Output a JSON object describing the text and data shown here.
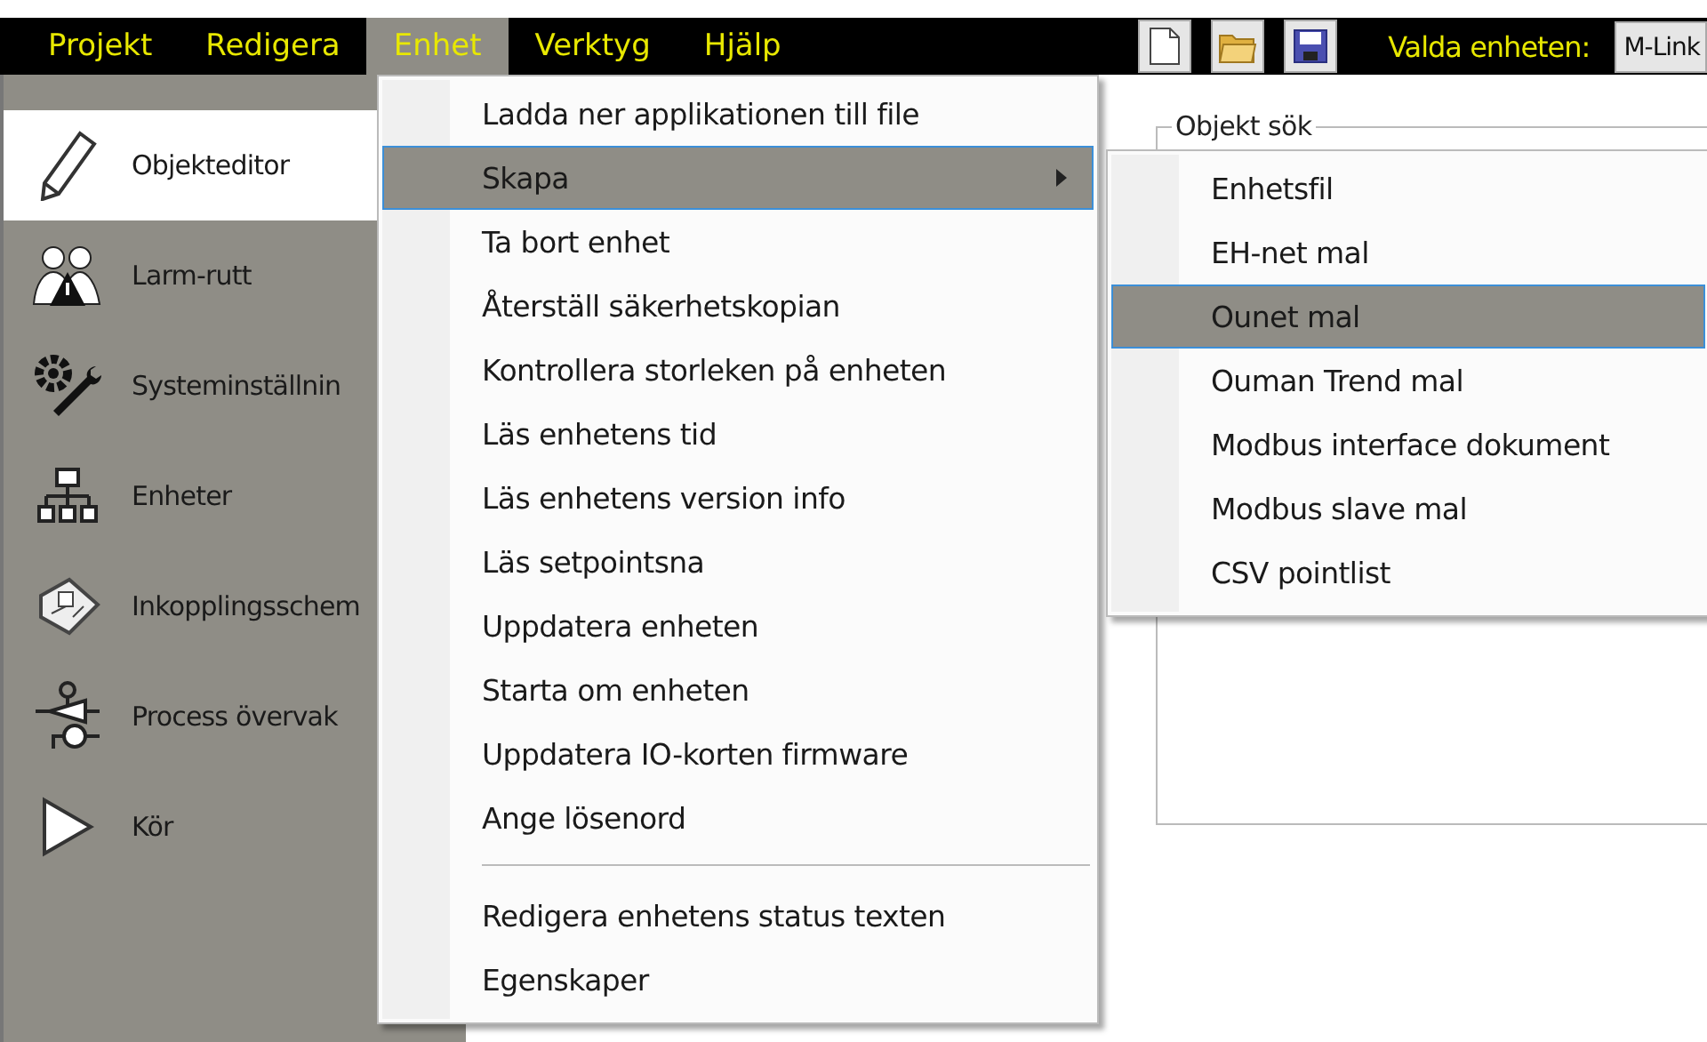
{
  "menubar": [
    {
      "label": "Projekt",
      "selected": false
    },
    {
      "label": "Redigera",
      "selected": false
    },
    {
      "label": "Enhet",
      "selected": true
    },
    {
      "label": "Verktyg",
      "selected": false
    },
    {
      "label": "Hjälp",
      "selected": false
    }
  ],
  "toolbar": {
    "device_label": "Valda enheten:",
    "device_value": "M-Link"
  },
  "sidebar": {
    "items": [
      {
        "label": "Objekteditor",
        "selected": true
      },
      {
        "label": "Larm-rutt",
        "selected": false
      },
      {
        "label": "Systeminställnin",
        "selected": false
      },
      {
        "label": "Enheter",
        "selected": false
      },
      {
        "label": "Inkopplingsschem",
        "selected": false
      },
      {
        "label": "Process övervak",
        "selected": false
      },
      {
        "label": "Kör",
        "selected": false
      }
    ]
  },
  "groupbox": {
    "title": "Objekt sök"
  },
  "menu": {
    "items": [
      {
        "kind": "item",
        "label": "Ladda ner applikationen till file",
        "selected": false
      },
      {
        "kind": "submenu",
        "label": "Skapa",
        "selected": true
      },
      {
        "kind": "item",
        "label": "Ta bort enhet",
        "selected": false
      },
      {
        "kind": "item",
        "label": "Återställ säkerhetskopian",
        "selected": false
      },
      {
        "kind": "item",
        "label": "Kontrollera storleken på enheten",
        "selected": false
      },
      {
        "kind": "item",
        "label": "Läs enhetens tid",
        "selected": false
      },
      {
        "kind": "item",
        "label": "Läs enhetens version info",
        "selected": false
      },
      {
        "kind": "item",
        "label": "Läs setpointsna",
        "selected": false
      },
      {
        "kind": "item",
        "label": "Uppdatera enheten",
        "selected": false
      },
      {
        "kind": "item",
        "label": "Starta om enheten",
        "selected": false
      },
      {
        "kind": "item",
        "label": "Uppdatera IO-korten firmware",
        "selected": false
      },
      {
        "kind": "item",
        "label": "Ange lösenord",
        "selected": false
      },
      {
        "kind": "separator"
      },
      {
        "kind": "item",
        "label": "Redigera enhetens status texten",
        "selected": false
      },
      {
        "kind": "item",
        "label": "Egenskaper",
        "selected": false
      }
    ]
  },
  "submenu": {
    "items": [
      {
        "kind": "item",
        "label": "Enhetsfil",
        "selected": false
      },
      {
        "kind": "item",
        "label": "EH-net mal",
        "selected": false
      },
      {
        "kind": "item",
        "label": "Ounet mal",
        "selected": true
      },
      {
        "kind": "item",
        "label": "Ouman Trend mal",
        "selected": false
      },
      {
        "kind": "item",
        "label": "Modbus interface dokument",
        "selected": false
      },
      {
        "kind": "item",
        "label": "Modbus slave mal",
        "selected": false
      },
      {
        "kind": "item",
        "label": "CSV pointlist",
        "selected": false
      }
    ]
  }
}
